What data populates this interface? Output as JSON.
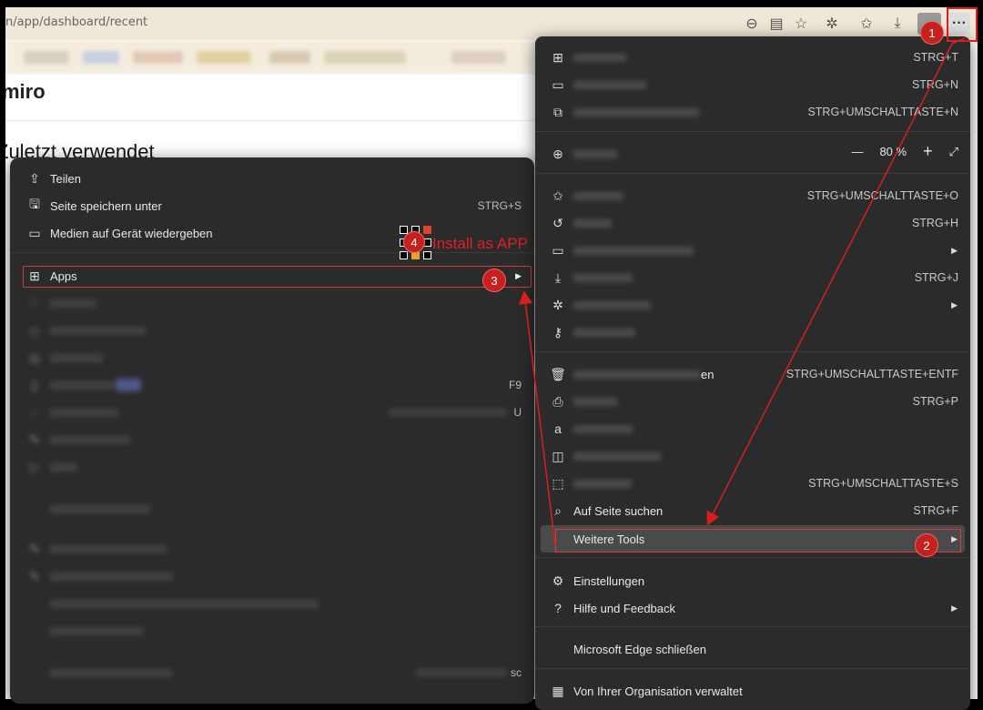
{
  "browser": {
    "url": "n/app/dashboard/recent"
  },
  "page": {
    "brand": "miro",
    "heading": "Zuletzt verwendet"
  },
  "left_menu": {
    "items": [
      {
        "icon": "share-icon",
        "label": "Teilen",
        "shortcut": ""
      },
      {
        "icon": "save-page-icon",
        "label": "Seite speichern unter",
        "shortcut": "STRG+S"
      },
      {
        "icon": "cast-icon",
        "label": "Medien auf Gerät wiedergeben",
        "shortcut": ""
      },
      {
        "icon": "apps-icon",
        "label": "Apps",
        "shortcut": ""
      }
    ],
    "blurred_shortcuts": [
      "F9",
      "U",
      "sc"
    ]
  },
  "main_menu": {
    "items": [
      {
        "label": "",
        "shortcut": "STRG+T"
      },
      {
        "label": "",
        "shortcut": "STRG+N"
      },
      {
        "label": "",
        "shortcut": "STRG+UMSCHALTTASTE+N"
      },
      {
        "label": "",
        "shortcut": ""
      },
      {
        "label": "",
        "shortcut": "STRG+UMSCHALTTASTE+O"
      },
      {
        "label": "",
        "shortcut": "STRG+H"
      },
      {
        "label": "",
        "shortcut": ""
      },
      {
        "label": "",
        "shortcut": "STRG+J"
      },
      {
        "label": "",
        "shortcut": ""
      },
      {
        "label": "",
        "shortcut": ""
      },
      {
        "label": "en",
        "shortcut": "STRG+UMSCHALTTASTE+ENTF"
      },
      {
        "label": "",
        "shortcut": "STRG+P"
      },
      {
        "label": "",
        "shortcut": ""
      },
      {
        "label": "",
        "shortcut": ""
      },
      {
        "label": "",
        "shortcut": "STRG+UMSCHALTTASTE+S"
      },
      {
        "label": "Auf Seite suchen",
        "shortcut": "STRG+F"
      },
      {
        "label": "Weitere Tools",
        "shortcut": ""
      },
      {
        "label": "Einstellungen",
        "shortcut": ""
      },
      {
        "label": "Hilfe und Feedback",
        "shortcut": ""
      },
      {
        "label": "Microsoft Edge schließen",
        "shortcut": ""
      },
      {
        "label": "Von Ihrer Organisation verwaltet",
        "shortcut": ""
      }
    ],
    "zoom": {
      "minus": "—",
      "value": "80 %",
      "plus": "+"
    }
  },
  "annotations": {
    "badge1": "1",
    "badge2": "2",
    "badge3": "3",
    "badge4": "4",
    "install_text": "Install as APP"
  },
  "colors": {
    "menu_bg": "#2b2b2b",
    "annotation_red": "#d81e1e"
  }
}
